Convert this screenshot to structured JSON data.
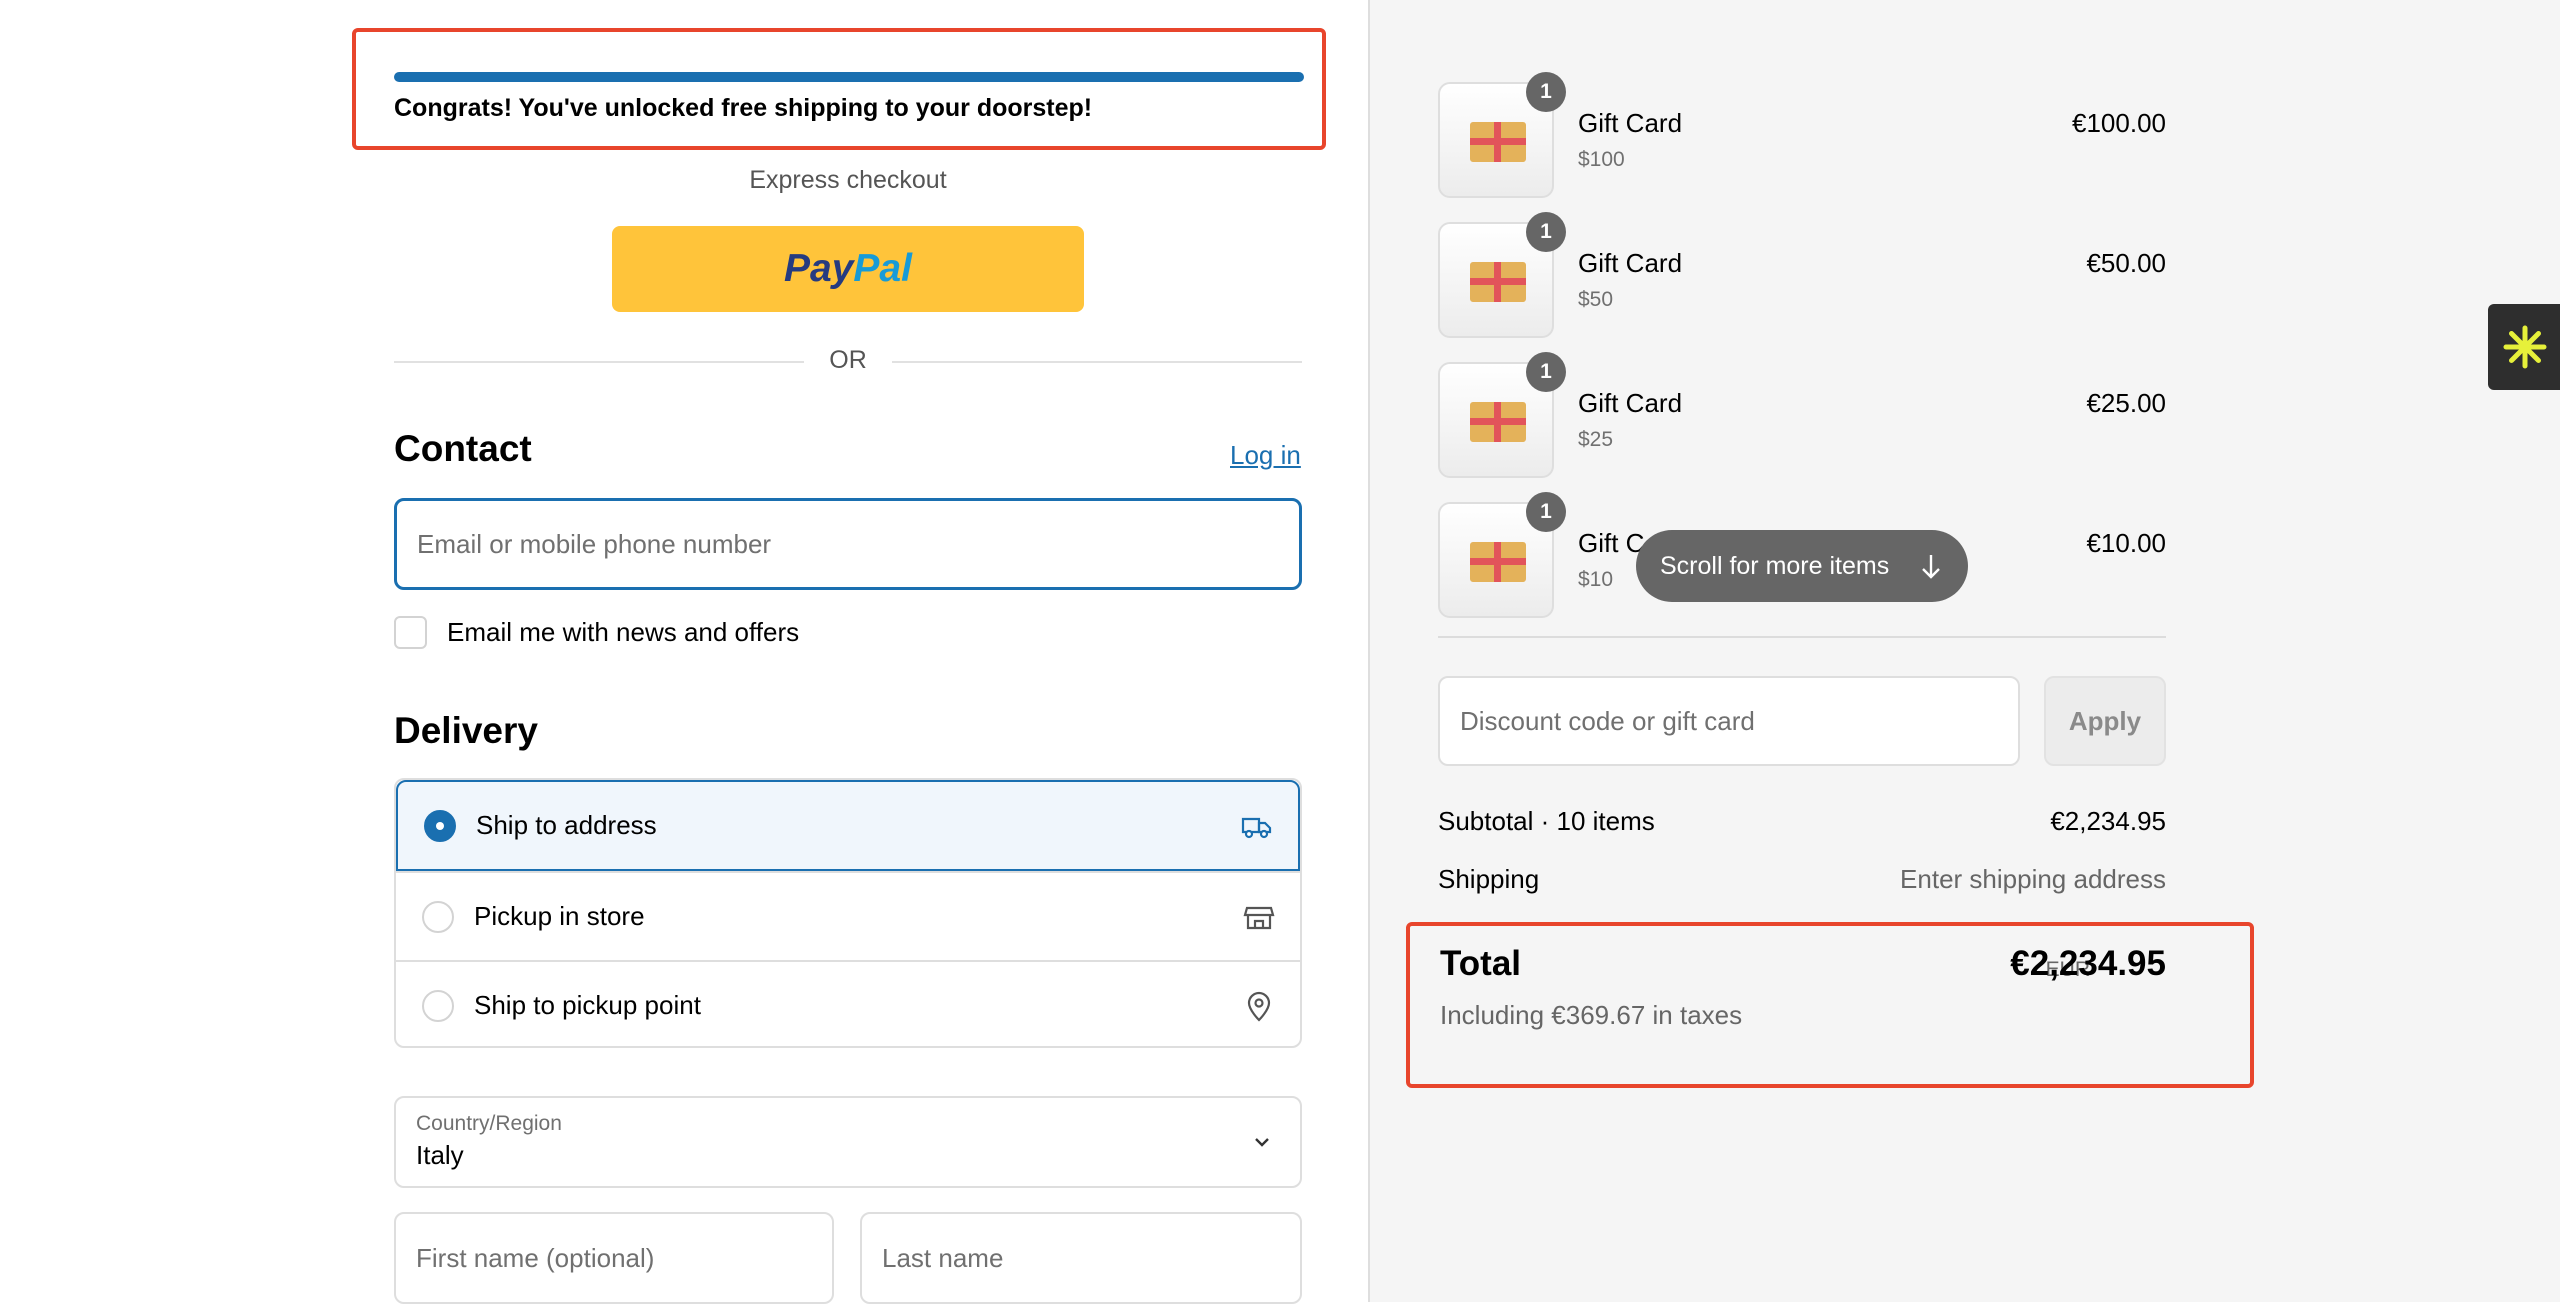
{
  "banner": {
    "message": "Congrats! You've unlocked free shipping to your doorstep!",
    "progress": 1.0
  },
  "express": {
    "label": "Express checkout",
    "paypal_part1": "Pay",
    "paypal_part2": "Pal"
  },
  "divider": {
    "or": "OR"
  },
  "contact": {
    "title": "Contact",
    "login": "Log in",
    "email_placeholder": "Email or mobile phone number",
    "news_label": "Email me with news and offers",
    "news_checked": false
  },
  "delivery": {
    "title": "Delivery",
    "options": [
      {
        "label": "Ship to address",
        "selected": true,
        "icon": "truck-icon"
      },
      {
        "label": "Pickup in store",
        "selected": false,
        "icon": "store-icon"
      },
      {
        "label": "Ship to pickup point",
        "selected": false,
        "icon": "location-pin-icon"
      }
    ],
    "country_label": "Country/Region",
    "country_value": "Italy",
    "first_name_placeholder": "First name (optional)",
    "last_name_placeholder": "Last name"
  },
  "cart": {
    "items": [
      {
        "qty": "1",
        "name": "Gift Card",
        "variant": "$100",
        "price": "€100.00"
      },
      {
        "qty": "1",
        "name": "Gift Card",
        "variant": "$50",
        "price": "€50.00"
      },
      {
        "qty": "1",
        "name": "Gift Card",
        "variant": "$25",
        "price": "€25.00"
      },
      {
        "qty": "1",
        "name": "Gift C",
        "variant": "$10",
        "price": "€10.00"
      }
    ],
    "scroll_hint": "Scroll for more items",
    "discount_placeholder": "Discount code or gift card",
    "apply_label": "Apply",
    "subtotal_label": "Subtotal · 10 items",
    "subtotal_value": "€2,234.95",
    "shipping_label": "Shipping",
    "shipping_value": "Enter shipping address",
    "total_label": "Total",
    "currency": "EUR",
    "total_value": "€2,234.95",
    "tax_note": "Including €369.67 in taxes"
  },
  "colors": {
    "accent": "#1a6fb0",
    "highlight_border": "#e8452c",
    "paypal_yellow": "#ffc43a",
    "widget_yellow": "#e6f03a"
  }
}
